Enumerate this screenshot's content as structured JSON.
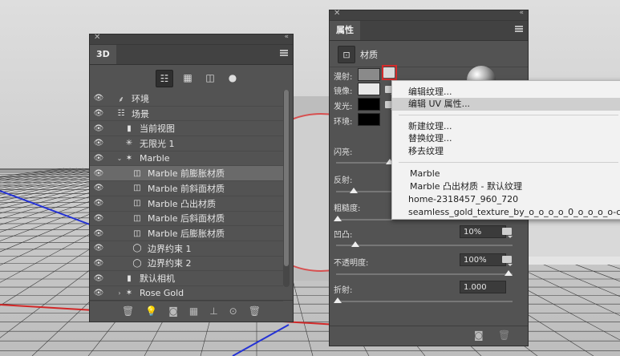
{
  "panel_3d": {
    "tab": "3D",
    "layers": [
      {
        "label": "环境",
        "icon": "environment-icon",
        "indent": 0,
        "arrow": ""
      },
      {
        "label": "场景",
        "icon": "scene-icon",
        "indent": 0,
        "arrow": ""
      },
      {
        "label": "当前视图",
        "icon": "camera-icon",
        "indent": 1,
        "arrow": ""
      },
      {
        "label": "无限光 1",
        "icon": "light-icon",
        "indent": 1,
        "arrow": ""
      },
      {
        "label": "Marble",
        "icon": "mesh-icon",
        "indent": 1,
        "arrow": "⌄"
      },
      {
        "label": "Marble 前膨胀材质",
        "icon": "material-icon",
        "indent": 2,
        "arrow": "",
        "selected": true
      },
      {
        "label": "Marble 前斜面材质",
        "icon": "material-icon",
        "indent": 2,
        "arrow": ""
      },
      {
        "label": "Marble 凸出材质",
        "icon": "material-icon",
        "indent": 2,
        "arrow": ""
      },
      {
        "label": "Marble 后斜面材质",
        "icon": "material-icon",
        "indent": 2,
        "arrow": ""
      },
      {
        "label": "Marble 后膨胀材质",
        "icon": "material-icon",
        "indent": 2,
        "arrow": ""
      },
      {
        "label": "边界约束 1",
        "icon": "constraint-icon",
        "indent": 2,
        "arrow": ""
      },
      {
        "label": "边界约束 2",
        "icon": "constraint-icon",
        "indent": 2,
        "arrow": ""
      },
      {
        "label": "默认相机",
        "icon": "camera-icon",
        "indent": 1,
        "arrow": ""
      },
      {
        "label": "Rose Gold",
        "icon": "mesh-icon",
        "indent": 1,
        "arrow": "›"
      }
    ]
  },
  "panel_props": {
    "tab": "属性",
    "section": "材质",
    "rows": {
      "diffuse": "漫射:",
      "specular": "镜像:",
      "glow": "发光:",
      "ambient": "环境:",
      "shine": "闪亮:",
      "reflection": "反射:",
      "roughness": "粗糙度:",
      "bump": "凹凸:",
      "opacity": "不透明度:",
      "refraction": "折射:"
    },
    "values": {
      "bump": "10%",
      "opacity": "100%",
      "refraction": "1.000"
    }
  },
  "context_menu": {
    "edit_texture": "编辑纹理...",
    "edit_uv": "编辑 UV 属性...",
    "new_texture": "新建纹理...",
    "replace_texture": "替换纹理...",
    "remove_texture": "移去纹理",
    "tex1": "Marble",
    "tex2": "Marble 凸出材质 - 默认纹理",
    "tex3": "home-2318457_960_720",
    "tex4": "seamless_gold_texture_by_o_o_o_o_0_o_o_o_o-c"
  },
  "colors": {
    "panel_bg": "#535353",
    "highlight_red": "#d42b2b",
    "menu_bg": "#f2f2f2"
  }
}
